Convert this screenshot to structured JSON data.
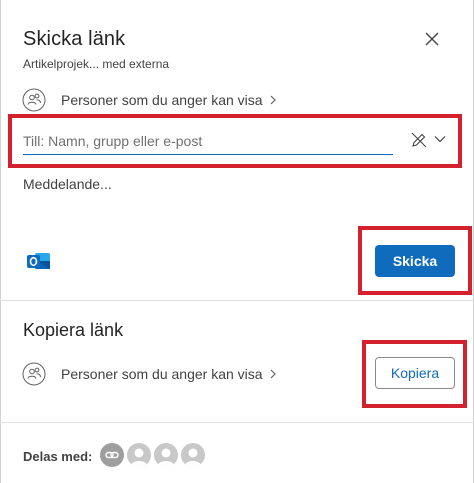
{
  "dialog": {
    "title": "Skicka länk",
    "subtitle": "Artikelprojek... med externa",
    "close_icon": "close-icon"
  },
  "permissions": {
    "label": "Personer som du anger kan visa",
    "icon": "people-icon"
  },
  "recipients": {
    "placeholder": "Till: Namn, grupp eller e-post",
    "value": "",
    "pencil_icon": "pencil-slash-icon",
    "dropdown_icon": "chevron-down-icon"
  },
  "message": {
    "placeholder": "Meddelande..."
  },
  "send": {
    "label": "Skicka",
    "outlook_icon": "outlook-icon"
  },
  "copy_section": {
    "title": "Kopiera länk",
    "permission_label": "Personer som du anger kan visa",
    "button_label": "Kopiera"
  },
  "shared_with": {
    "label": "Delas med:",
    "avatars": [
      "link-icon",
      "person-avatar",
      "person-avatar",
      "person-avatar"
    ]
  },
  "colors": {
    "accent": "#0f6cbd",
    "highlight": "#d3212d",
    "divider": "#e0e0e0"
  }
}
